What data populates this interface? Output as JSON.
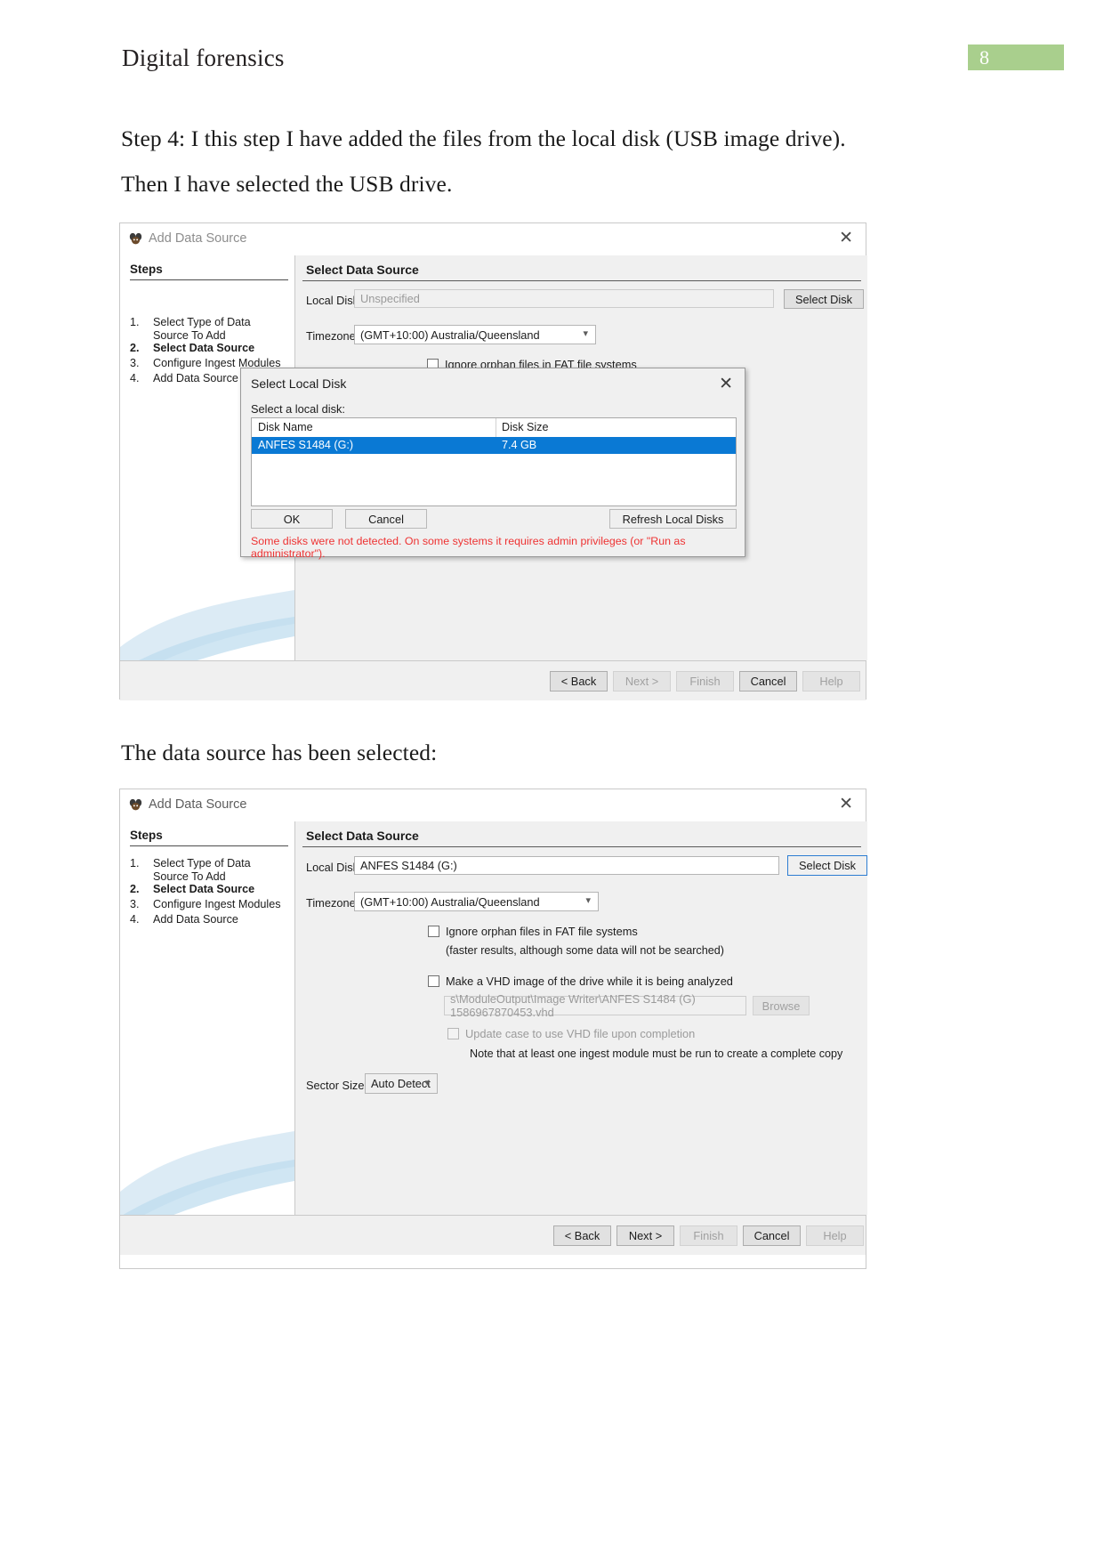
{
  "document": {
    "header_title": "Digital forensics",
    "page_number": "8",
    "accent_green": "#a9cf8d",
    "paragraph_1": "Step 4: I this step I have added the files from the local disk (USB image drive). Then I have selected the USB drive.",
    "paragraph_2": "The data source has been selected:"
  },
  "wizard1": {
    "window_title": "Add Data Source",
    "close_label": "✕",
    "steps_heading": "Steps",
    "steps": [
      {
        "num": "1.",
        "label": "Select Type of Data Source To Add",
        "active": false
      },
      {
        "num": "2.",
        "label": "Select Data Source",
        "active": true
      },
      {
        "num": "3.",
        "label": "Configure Ingest Modules",
        "active": false
      },
      {
        "num": "4.",
        "label": "Add Data Source",
        "active": false
      }
    ],
    "pane_heading": "Select Data Source",
    "local_disk_label": "Local Disk:",
    "local_disk_value": "Unspecified",
    "select_disk_button": "Select Disk",
    "timezone_label": "Timezone:",
    "timezone_value": "(GMT+10:00) Australia/Queensland",
    "ignore_orphan_label": "Ignore orphan files in FAT file systems",
    "footer_buttons": [
      {
        "label": "< Back",
        "disabled": false
      },
      {
        "label": "Next >",
        "disabled": true
      },
      {
        "label": "Finish",
        "disabled": true
      },
      {
        "label": "Cancel",
        "disabled": false
      },
      {
        "label": "Help",
        "disabled": true
      }
    ]
  },
  "modal": {
    "title": "Select Local Disk",
    "close_label": "✕",
    "subtitle": "Select a local disk:",
    "columns": [
      "Disk Name",
      "Disk Size"
    ],
    "rows": [
      {
        "name": "ANFES S1484 (G:)",
        "size": "7.4 GB",
        "selected": true
      }
    ],
    "ok_button": "OK",
    "cancel_button": "Cancel",
    "refresh_button": "Refresh Local Disks",
    "warning": "Some disks were not detected. On some systems it requires admin privileges (or \"Run as administrator\").",
    "warning_color": "#ee3333",
    "selection_color": "#0a79d4"
  },
  "wizard2": {
    "window_title": "Add Data Source",
    "close_label": "✕",
    "steps_heading": "Steps",
    "steps": [
      {
        "num": "1.",
        "label": "Select Type of Data Source To Add",
        "active": false
      },
      {
        "num": "2.",
        "label": "Select Data Source",
        "active": true
      },
      {
        "num": "3.",
        "label": "Configure Ingest Modules",
        "active": false
      },
      {
        "num": "4.",
        "label": "Add Data Source",
        "active": false
      }
    ],
    "pane_heading": "Select Data Source",
    "local_disk_label": "Local Disk:",
    "local_disk_value": "ANFES S1484 (G:)",
    "select_disk_button": "Select Disk",
    "timezone_label": "Timezone:",
    "timezone_value": "(GMT+10:00) Australia/Queensland",
    "ignore_orphan_label": "Ignore orphan files in FAT file systems",
    "ignore_orphan_note": "(faster results, although some data will not be searched)",
    "make_vhd_label": "Make a VHD image of the drive while it is being analyzed",
    "vhd_path_value": "s\\ModuleOutput\\Image Writer\\ANFES S1484 (G) 1586967870453.vhd",
    "browse_button": "Browse",
    "update_case_label": "Update case to use VHD file upon completion",
    "ingest_note": "Note that at least one ingest module must be run to create a complete copy",
    "sector_size_label": "Sector Size:",
    "sector_size_value": "Auto Detect",
    "footer_buttons": [
      {
        "label": "< Back",
        "disabled": false
      },
      {
        "label": "Next >",
        "disabled": false
      },
      {
        "label": "Finish",
        "disabled": true
      },
      {
        "label": "Cancel",
        "disabled": false
      },
      {
        "label": "Help",
        "disabled": true
      }
    ]
  }
}
